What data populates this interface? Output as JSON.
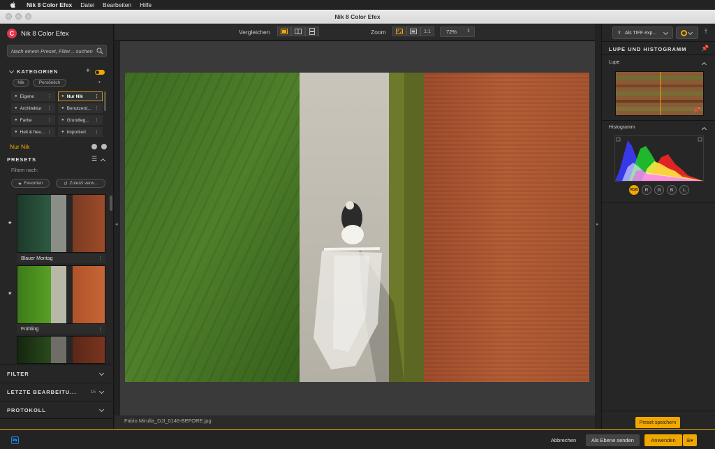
{
  "menubar": {
    "app_name": "Nik 8 Color Efex",
    "items": [
      "Datei",
      "Bearbeiten",
      "Hilfe"
    ]
  },
  "window": {
    "title": "Nik 8 Color Efex"
  },
  "left_panel": {
    "brand": "Nik 8 Color Efex",
    "search_placeholder": "Nach einem Preset, Filter... suchen",
    "categories": {
      "title": "KATEGORIEN",
      "tabs": [
        "Nik",
        "Persönlich"
      ],
      "items": [
        {
          "label": "Eigene",
          "selected": false
        },
        {
          "label": "Nur Nik",
          "selected": true
        },
        {
          "label": "Architektur",
          "selected": false
        },
        {
          "label": "Benutzerd...",
          "selected": false
        },
        {
          "label": "Farbe",
          "selected": false
        },
        {
          "label": "Grundleg...",
          "selected": false
        },
        {
          "label": "Hell & freu...",
          "selected": false
        },
        {
          "label": "Importiert",
          "selected": false
        }
      ]
    },
    "active_category": "Nur Nik",
    "presets": {
      "title": "PRESETS",
      "filter_label": "Filtern nach:",
      "filters": [
        "Favoriten",
        "Zuletzt verw..."
      ],
      "items": [
        {
          "name": "Blauer Montag"
        },
        {
          "name": "Frühling"
        }
      ]
    },
    "sections": [
      {
        "label": "FILTER",
        "count": ""
      },
      {
        "label": "LETZTE BEARBEITU...",
        "count": "15"
      },
      {
        "label": "PROTOKOLL",
        "count": ""
      }
    ]
  },
  "toolbar": {
    "compare_label": "Vergleichen",
    "zoom_label": "Zoom",
    "zoom_1to1": "1:1",
    "zoom_value": "72%"
  },
  "canvas": {
    "filename": "Fabio Mirulla_DJI_0146-BEFORE.jpg"
  },
  "right_panel": {
    "export_label": "Als TIFF exp...",
    "title": "LUPE UND HISTOGRAMM",
    "lupe_label": "Lupe",
    "histogram_label": "Histogramm",
    "channels": [
      "RGB",
      "R",
      "G",
      "B",
      "L"
    ],
    "save_preset": "Preset speichern"
  },
  "footer": {
    "ps_label": "Ps",
    "cancel": "Abbrechen",
    "send_layer": "Als Ebene senden",
    "apply": "Anwenden"
  },
  "colors": {
    "accent": "#f0a800",
    "brand": "#e4354a"
  }
}
